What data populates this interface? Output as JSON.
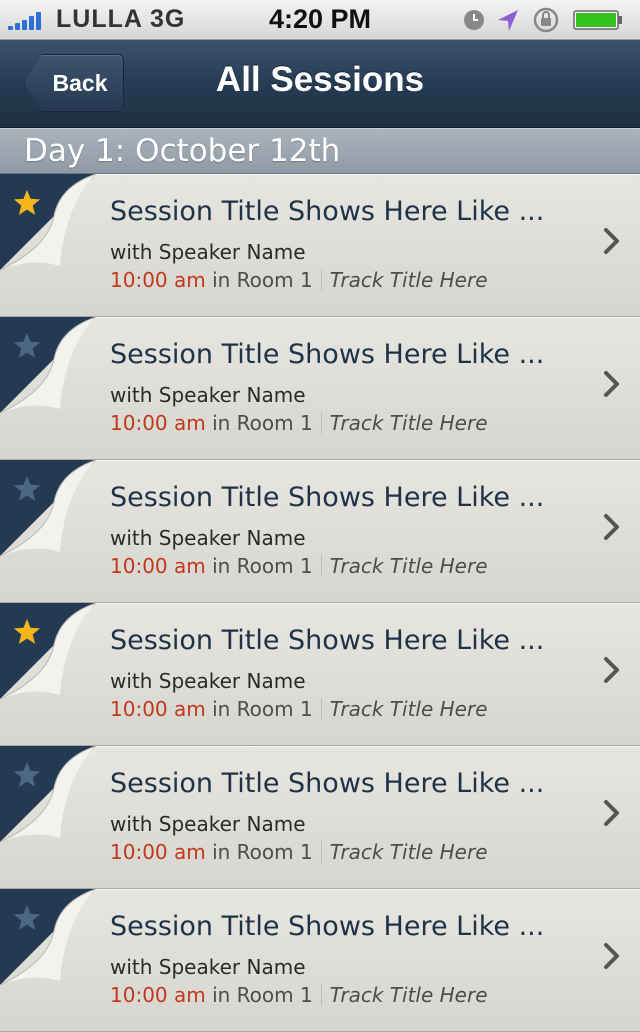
{
  "status_bar": {
    "carrier": "LULLA 3G",
    "time": "4:20 PM",
    "signal_bars": 5,
    "icons": [
      "clock-icon",
      "location-arrow-icon",
      "rotation-lock-icon",
      "battery-icon"
    ],
    "battery_color": "#36c31f"
  },
  "nav": {
    "back_label": "Back",
    "title": "All Sessions"
  },
  "section": {
    "header": "Day 1: October 12th"
  },
  "colors": {
    "accent_time": "#c0391b",
    "nav_blue": "#273c53",
    "star_active": "#f4b51b",
    "star_inactive": "#4e6784"
  },
  "sessions": [
    {
      "title": "Session Title Shows Here Like ...",
      "speaker": "with Speaker Name",
      "time": "10:00 am",
      "room": "in Room 1",
      "track": "Track Title Here",
      "starred": true
    },
    {
      "title": "Session Title Shows Here Like ...",
      "speaker": "with Speaker Name",
      "time": "10:00 am",
      "room": "in Room 1",
      "track": "Track Title Here",
      "starred": false
    },
    {
      "title": "Session Title Shows Here Like ...",
      "speaker": "with Speaker Name",
      "time": "10:00 am",
      "room": "in Room 1",
      "track": "Track Title Here",
      "starred": false
    },
    {
      "title": "Session Title Shows Here Like ...",
      "speaker": "with Speaker Name",
      "time": "10:00 am",
      "room": "in Room 1",
      "track": "Track Title Here",
      "starred": true
    },
    {
      "title": "Session Title Shows Here Like ...",
      "speaker": "with Speaker Name",
      "time": "10:00 am",
      "room": "in Room 1",
      "track": "Track Title Here",
      "starred": false
    },
    {
      "title": "Session Title Shows Here Like ...",
      "speaker": "with Speaker Name",
      "time": "10:00 am",
      "room": "in Room 1",
      "track": "Track Title Here",
      "starred": false
    }
  ]
}
